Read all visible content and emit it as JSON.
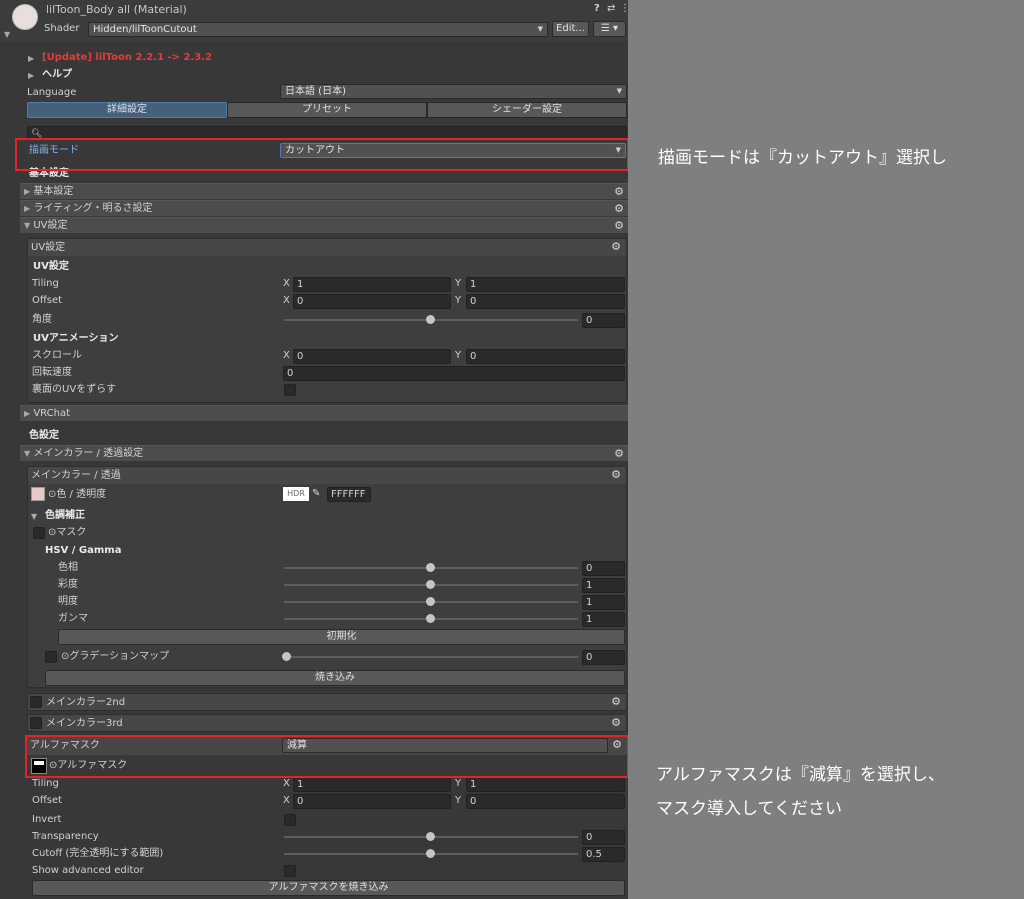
{
  "header": {
    "title": "lilToon_Body all (Material)",
    "shader_label": "Shader",
    "shader_value": "Hidden/lilToonCutout",
    "edit_button": "Edit...",
    "help_icon": "?",
    "settings_icon": "⇄",
    "menu_icon": "⋮"
  },
  "top": {
    "update_notice": "[Update] lilToon 2.2.1 -> 2.3.2",
    "help": "ヘルプ",
    "language_label": "Language",
    "language_value": "日本語 (日本)",
    "tabs": [
      "詳細設定",
      "プリセット",
      "シェーダー設定"
    ],
    "search_placeholder": ""
  },
  "render_mode": {
    "label": "描画モード",
    "value": "カットアウト"
  },
  "base": {
    "section_title": "基本設定",
    "folds": [
      "基本設定",
      "ライティング・明るさ設定",
      "UV設定"
    ]
  },
  "uv": {
    "box_title": "UV設定",
    "sub_title": "UV設定",
    "tiling_label": "Tiling",
    "tiling_x": "1",
    "tiling_y": "1",
    "offset_label": "Offset",
    "offset_x": "0",
    "offset_y": "0",
    "angle_label": "角度",
    "angle_value": "0",
    "anim_title": "UVアニメーション",
    "scroll_label": "スクロール",
    "scroll_x": "0",
    "scroll_y": "0",
    "rotate_label": "回転速度",
    "rotate_value": "0",
    "backface_label": "裏面のUVをずらす",
    "x": "X",
    "y": "Y"
  },
  "vrchat": {
    "label": "VRChat"
  },
  "color": {
    "section_title": "色設定",
    "fold_label": "メインカラー / 透過設定",
    "box_title": "メインカラー / 透過",
    "main_color_label": "⊙色 / 透明度",
    "hdr": "HDR",
    "hex": "FFFFFF",
    "tone_title": "色調補正",
    "mask_label": "⊙マスク",
    "hsv_title": "HSV / Gamma",
    "hue_label": "色相",
    "hue_value": "0",
    "sat_label": "彩度",
    "sat_value": "1",
    "val_label": "明度",
    "val_value": "1",
    "gamma_label": "ガンマ",
    "gamma_value": "1",
    "reset_button": "初期化",
    "gradation_label": "⊙グラデーションマップ",
    "gradation_value": "0",
    "bake_button": "焼き込み",
    "main2_label": "メインカラー2nd",
    "main3_label": "メインカラー3rd"
  },
  "alpha_mask": {
    "label": "アルファマスク",
    "mode_value": "減算",
    "texture_label": "⊙アルファマスク",
    "tiling_label": "Tiling",
    "tiling_x": "1",
    "tiling_y": "1",
    "offset_label": "Offset",
    "offset_x": "0",
    "offset_y": "0",
    "invert_label": "Invert",
    "transparency_label": "Transparency",
    "transparency_value": "0",
    "cutoff_label": "Cutoff (完全透明にする範囲)",
    "cutoff_value": "0.5",
    "advanced_label": "Show advanced editor",
    "bake_button": "アルファマスクを焼き込み"
  },
  "annotations": {
    "note1": "描画モードは『カットアウト』選択し",
    "note2_line1": "アルファマスクは『減算』を選択し、",
    "note2_line2": "マスク導入してください"
  },
  "colors": {
    "highlight": "#e5212a",
    "update_text": "#e83a3a",
    "selected_tab": "#46607c",
    "render_label": "#7fb2ee"
  }
}
